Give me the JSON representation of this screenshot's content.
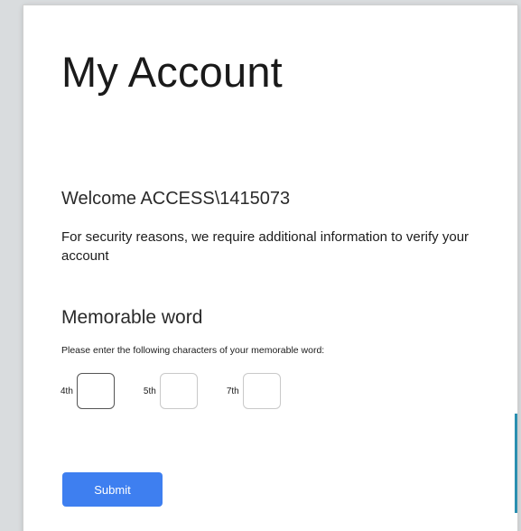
{
  "header": {
    "title": "My Account"
  },
  "welcome": {
    "text": "Welcome ACCESS\\1415073",
    "security_message": "For security reasons, we require additional information to verify your account"
  },
  "memorable_word": {
    "heading": "Memorable word",
    "instruction": "Please enter the following characters of your memorable word:",
    "fields": [
      {
        "label": "4th",
        "value": ""
      },
      {
        "label": "5th",
        "value": ""
      },
      {
        "label": "7th",
        "value": ""
      }
    ]
  },
  "actions": {
    "submit_label": "Submit"
  },
  "colors": {
    "submit_background": "#3e7ff0",
    "accent": "#2a8fb0"
  }
}
